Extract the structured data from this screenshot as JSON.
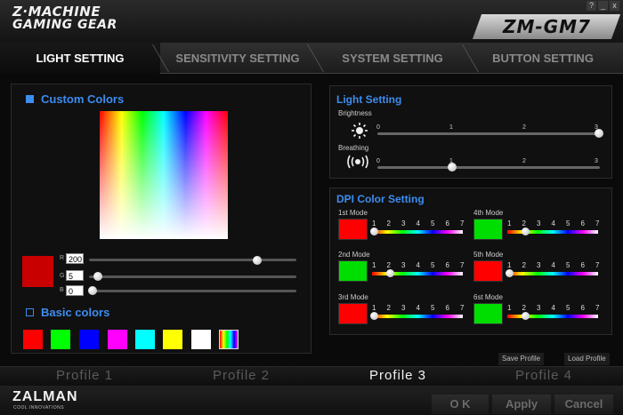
{
  "header": {
    "brand_line1": "Z·MACHINE",
    "brand_line2": "GAMING GEAR",
    "model": "ZM-GM7",
    "window_help": "?",
    "window_min": "_",
    "window_close": "x"
  },
  "tabs": [
    {
      "label": "LIGHT SETTING",
      "active": true
    },
    {
      "label": "SENSITIVITY SETTING",
      "active": false
    },
    {
      "label": "SYSTEM SETTING",
      "active": false
    },
    {
      "label": "BUTTON SETTING",
      "active": false
    }
  ],
  "custom_colors": {
    "title": "Custom Colors",
    "selected_color": "#c80000",
    "r_label": "R",
    "r_value": "200",
    "g_label": "G",
    "g_value": "5",
    "b_label": "B",
    "b_value": "0"
  },
  "basic_colors": {
    "title": "Basic colors",
    "swatches": [
      "#ff0000",
      "#00ff00",
      "#0000ff",
      "#ff00ff",
      "#00ffff",
      "#ffff00",
      "#ffffff",
      "rainbow"
    ]
  },
  "light_setting": {
    "title": "Light Setting",
    "brightness_label": "Brightness",
    "brightness_value": 3,
    "breathing_label": "Breathing",
    "breathing_value": 1,
    "ticks": [
      "0",
      "1",
      "2",
      "3"
    ]
  },
  "dpi_color": {
    "title": "DPI Color Setting",
    "levels": [
      "1",
      "2",
      "3",
      "4",
      "5",
      "6",
      "7"
    ],
    "modes": [
      {
        "label": "1st Mode",
        "color": "#ff0000",
        "level": 1
      },
      {
        "label": "4th Mode",
        "color": "#00dd00",
        "level": 2
      },
      {
        "label": "2nd Mode",
        "color": "#00dd00",
        "level": 2
      },
      {
        "label": "5th Mode",
        "color": "#ff0000",
        "level": 1
      },
      {
        "label": "3rd Mode",
        "color": "#ff0000",
        "level": 1
      },
      {
        "label": "6st Mode",
        "color": "#00dd00",
        "level": 2
      }
    ]
  },
  "profiles": {
    "save_label": "Save Profile",
    "load_label": "Load Profile",
    "items": [
      {
        "label": "Profile 1",
        "active": false
      },
      {
        "label": "Profile 2",
        "active": false
      },
      {
        "label": "Profile 3",
        "active": true
      },
      {
        "label": "Profile 4",
        "active": false
      }
    ]
  },
  "footer": {
    "brand": "ZALMAN",
    "tagline": "COOL INNOVATIONS",
    "ok_label": "O K",
    "apply_label": "Apply",
    "cancel_label": "Cancel"
  },
  "colors": {
    "accent": "#3d8cf0",
    "background": "#0a0a0a"
  }
}
